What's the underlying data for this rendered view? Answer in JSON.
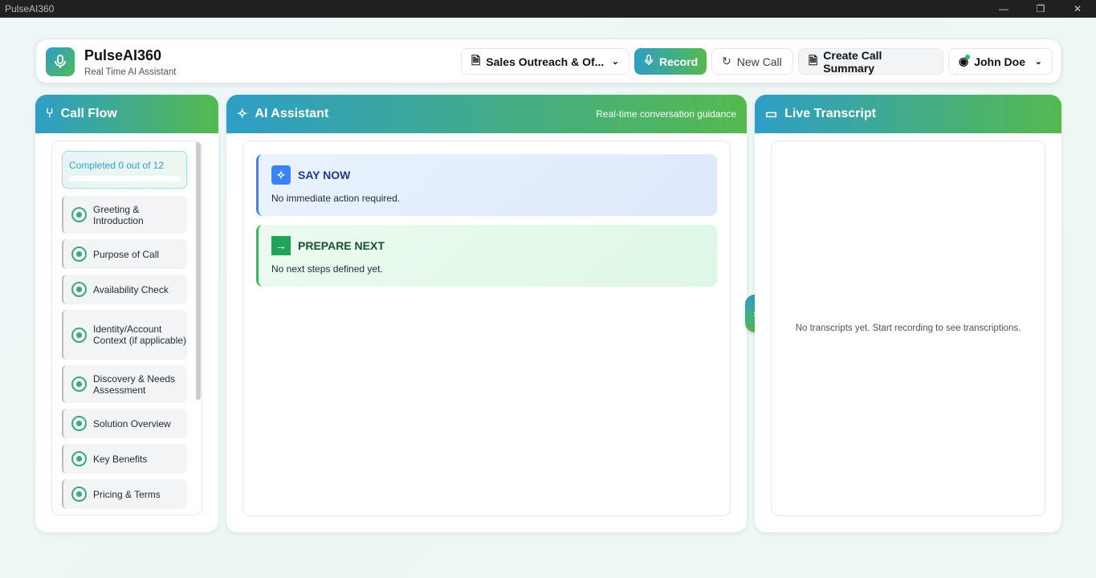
{
  "window": {
    "title": "PulseAI360"
  },
  "header": {
    "brand": "PulseAI360",
    "subtitle": "Real Time AI Assistant",
    "template_select": "Sales Outreach & Of...",
    "record": "Record",
    "new_call": "New Call",
    "summary": "Create Call Summary",
    "user": "John Doe"
  },
  "call_flow": {
    "title": "Call Flow",
    "progress": "Completed 0 out of 12",
    "completed": 0,
    "total": 12,
    "steps": [
      "Greeting & Introduction",
      "Purpose of Call",
      "Availability Check",
      "Identity/Account Context (if applicable)",
      "Discovery & Needs Assessment",
      "Solution Overview",
      "Key Benefits",
      "Pricing & Terms"
    ]
  },
  "assistant": {
    "title": "AI Assistant",
    "subtitle": "Real-time conversation guidance",
    "say_now": {
      "title": "SAY NOW",
      "body": "No immediate action required."
    },
    "prepare_next": {
      "title": "PREPARE NEXT",
      "body": "No next steps defined yet."
    }
  },
  "transcript": {
    "title": "Live Transcript",
    "empty": "No transcripts yet. Start recording to see transcriptions."
  },
  "colors": {
    "accent_start": "#2e9ec6",
    "accent_end": "#55b94f",
    "say_now": "#3b82f6",
    "prepare_next": "#22a35a"
  }
}
